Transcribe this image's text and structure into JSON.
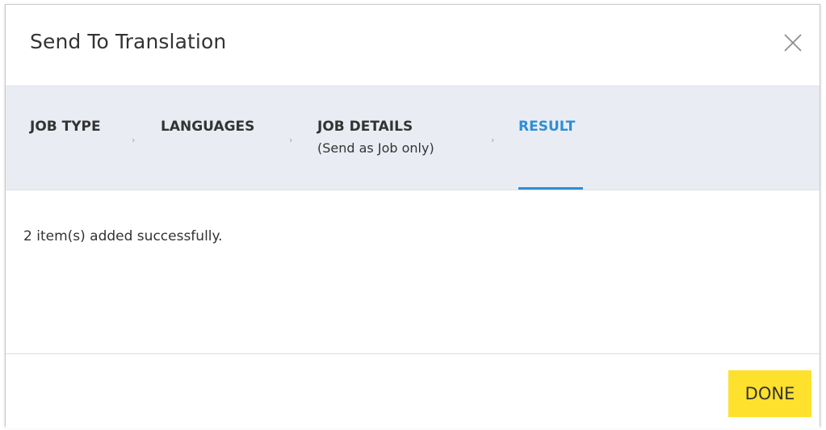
{
  "dialog": {
    "title": "Send To Translation"
  },
  "stepper": {
    "steps": [
      {
        "label": "JOB TYPE",
        "sublabel": ""
      },
      {
        "label": "LANGUAGES",
        "sublabel": ""
      },
      {
        "label": "JOB DETAILS",
        "sublabel": "(Send as Job only)"
      },
      {
        "label": "RESULT",
        "sublabel": ""
      }
    ],
    "active_step": "RESULT",
    "active_color": "#2e8ed6"
  },
  "content": {
    "message": "2 item(s) added successfully."
  },
  "footer": {
    "done_label": "DONE",
    "done_color": "#fde12d"
  },
  "icons": {
    "close": "close-icon",
    "chevron": "chevron-right-icon"
  }
}
